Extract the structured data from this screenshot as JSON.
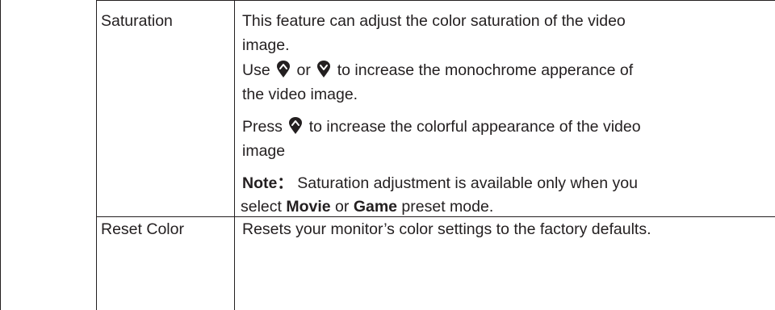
{
  "rows": [
    {
      "label": "Saturation",
      "lines": [
        "This feature can adjust the color saturation of the video",
        "image.",
        {
          "pre": "Use",
          "mid": "or",
          "post": "to increase the monochrome apperance of"
        },
        "the video image.",
        {
          "pre": "Press",
          "post": "to increase the colorful appearance of the video"
        },
        "image"
      ],
      "note": {
        "label": "Note：",
        "text1": "Saturation adjustment is available only when you",
        "text2_pre": "select ",
        "movie": "Movie",
        "or": " or ",
        "game": "Game",
        "text2_post": " preset mode."
      }
    },
    {
      "label": "Reset Color",
      "text": "Resets your monitor’s color settings to the factory defaults."
    }
  ],
  "icons": {
    "up": "up-arrow-button-icon",
    "down": "down-arrow-button-icon"
  }
}
